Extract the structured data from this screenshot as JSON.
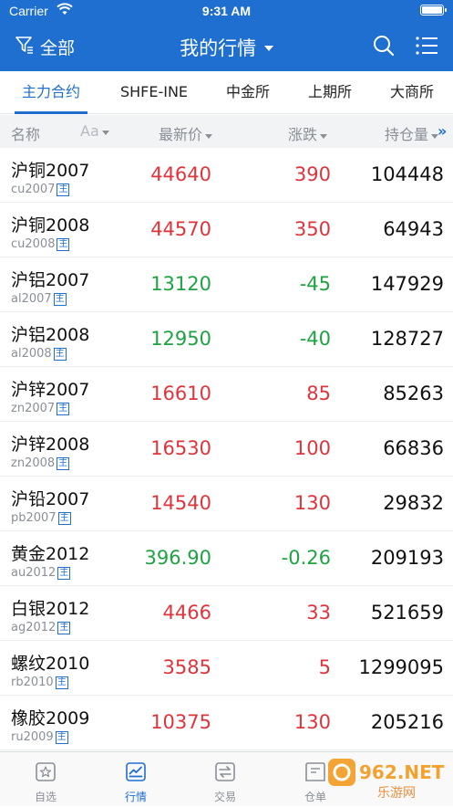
{
  "status_bar": {
    "carrier": "Carrier",
    "time": "9:31 AM"
  },
  "nav": {
    "filter_label": "全部",
    "title": "我的行情"
  },
  "tabs": [
    {
      "label": "主力合约",
      "active": true
    },
    {
      "label": "SHFE-INE",
      "active": false
    },
    {
      "label": "中金所",
      "active": false
    },
    {
      "label": "上期所",
      "active": false
    },
    {
      "label": "大商所",
      "active": false
    }
  ],
  "columns": {
    "name": "名称",
    "font_toggle": "Aa",
    "price": "最新价",
    "change": "涨跌",
    "open_interest": "持仓量",
    "more": "»"
  },
  "rows": [
    {
      "name": "沪铜2007",
      "code": "cu2007",
      "tag": "主",
      "price": "44640",
      "change": "390",
      "oi": "104448",
      "dir": "up"
    },
    {
      "name": "沪铜2008",
      "code": "cu2008",
      "tag": "主",
      "price": "44570",
      "change": "350",
      "oi": "64943",
      "dir": "up"
    },
    {
      "name": "沪铝2007",
      "code": "al2007",
      "tag": "主",
      "price": "13120",
      "change": "-45",
      "oi": "147929",
      "dir": "down"
    },
    {
      "name": "沪铝2008",
      "code": "al2008",
      "tag": "主",
      "price": "12950",
      "change": "-40",
      "oi": "128727",
      "dir": "down"
    },
    {
      "name": "沪锌2007",
      "code": "zn2007",
      "tag": "主",
      "price": "16610",
      "change": "85",
      "oi": "85263",
      "dir": "up"
    },
    {
      "name": "沪锌2008",
      "code": "zn2008",
      "tag": "主",
      "price": "16530",
      "change": "100",
      "oi": "66836",
      "dir": "up"
    },
    {
      "name": "沪铅2007",
      "code": "pb2007",
      "tag": "主",
      "price": "14540",
      "change": "130",
      "oi": "29832",
      "dir": "up"
    },
    {
      "name": "黄金2012",
      "code": "au2012",
      "tag": "主",
      "price": "396.90",
      "change": "-0.26",
      "oi": "209193",
      "dir": "down"
    },
    {
      "name": "白银2012",
      "code": "ag2012",
      "tag": "主",
      "price": "4466",
      "change": "33",
      "oi": "521659",
      "dir": "up"
    },
    {
      "name": "螺纹2010",
      "code": "rb2010",
      "tag": "主",
      "price": "3585",
      "change": "5",
      "oi": "1299095",
      "dir": "up"
    },
    {
      "name": "橡胶2009",
      "code": "ru2009",
      "tag": "主",
      "price": "10375",
      "change": "130",
      "oi": "205216",
      "dir": "up"
    }
  ],
  "tab_bar": [
    {
      "label": "自选",
      "icon": "star-icon",
      "active": false
    },
    {
      "label": "行情",
      "icon": "chart-icon",
      "active": true
    },
    {
      "label": "交易",
      "icon": "exchange-icon",
      "active": false
    },
    {
      "label": "仓单",
      "icon": "document-icon",
      "active": false
    }
  ],
  "watermark": {
    "text": "962.NET",
    "subtext": "乐游网"
  },
  "colors": {
    "brand": "#1f6fd1",
    "up": "#e0343c",
    "down": "#1ea342"
  }
}
